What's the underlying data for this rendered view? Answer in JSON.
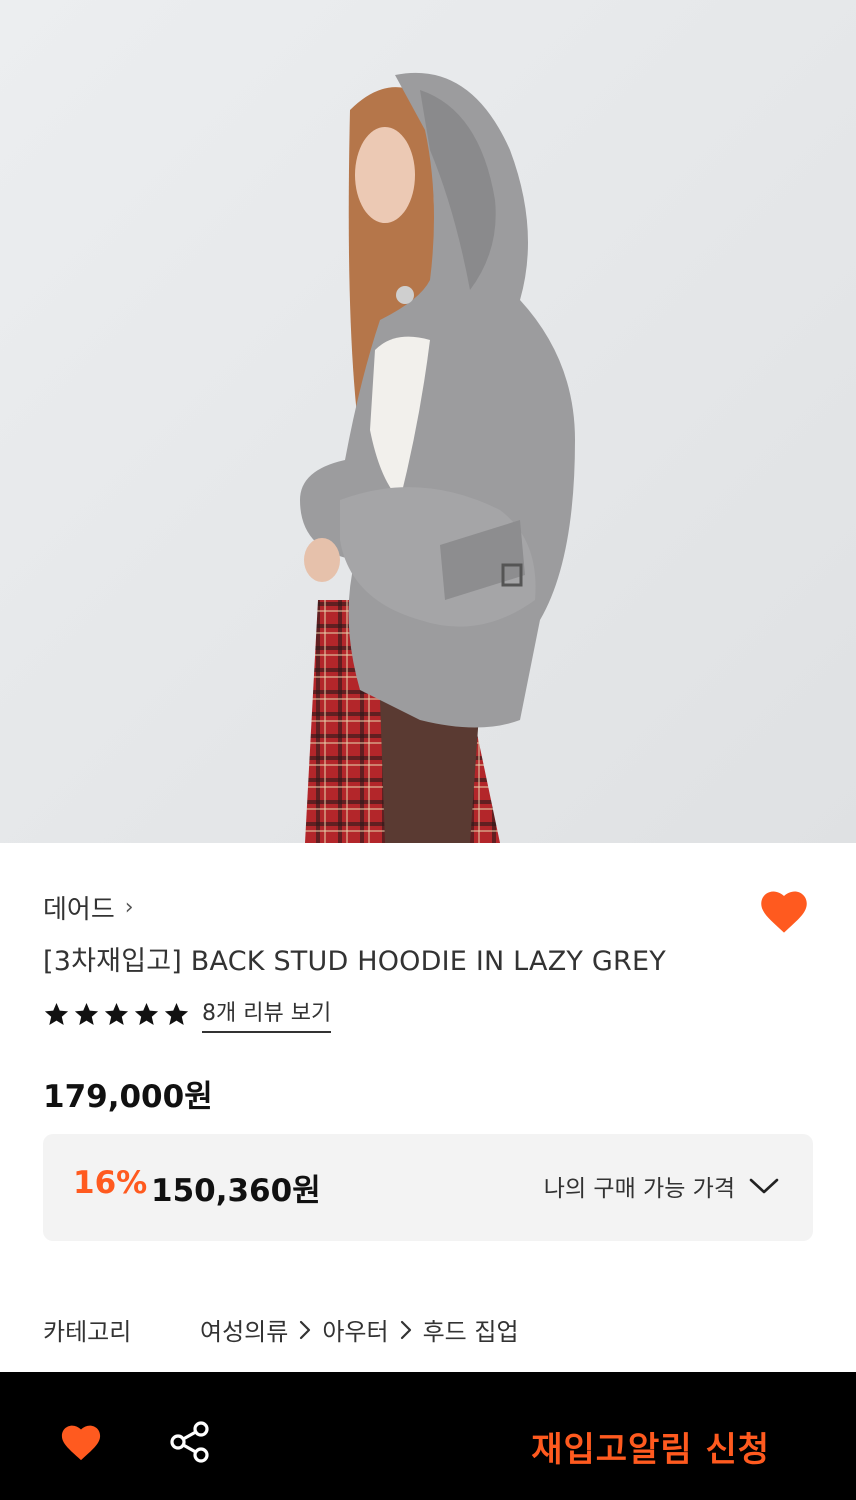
{
  "product": {
    "brand": "데어드",
    "brand_chevron": "›",
    "title": "[3차재입고] BACK STUD HOODIE IN LAZY GREY",
    "rating_stars": 5,
    "review_link": "8개 리뷰 보기",
    "price": "179,000원",
    "discount_rate": "16%",
    "sale_price": "150,360원",
    "my_price_label": "나의 구매 가능 가격",
    "wishlisted": true
  },
  "category": {
    "label": "카테고리",
    "path": [
      "여성의류",
      "아우터",
      "후드 집업"
    ]
  },
  "bottom_bar": {
    "restock_label": "재입고알림 신청"
  },
  "icons": {
    "wish": "heart-icon",
    "share": "share-icon",
    "dropdown": "chevron-down-icon",
    "breadcrumb_separator": "chevron-right-icon",
    "star": "star-icon"
  },
  "colors": {
    "accent": "#ff5a1f",
    "bottom_bar_bg": "#000000",
    "price_box_bg": "#f3f3f3"
  }
}
